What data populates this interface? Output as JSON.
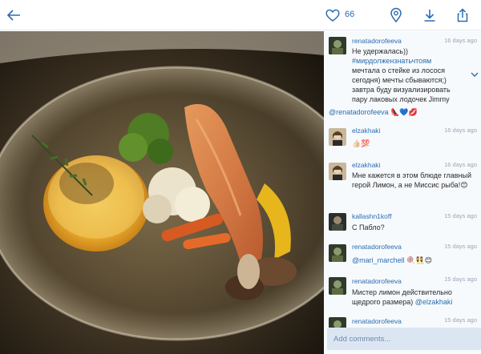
{
  "topbar": {
    "like_count": "66",
    "icons": [
      "back-arrow-icon",
      "heart-icon",
      "location-pin-icon",
      "download-icon",
      "share-icon"
    ]
  },
  "colors": {
    "accent": "#2b6cb0",
    "panel_bg": "#f7fafd",
    "input_bg": "#dce6f2"
  },
  "comments": [
    {
      "user": "renatadorofeeva",
      "time": "16 days ago",
      "lines": [
        "Не удержалась))",
        "#мирдолжензнатьчтоям",
        "мечтала о стейке из лосося",
        "сегодня) мечты сбываются;)",
        "завтра буду визуализировать",
        "пару лаковых лодочек Jimmy"
      ],
      "overflow": "@renatadorofeeva 👠💙💋"
    },
    {
      "user": "elzakhaki",
      "time": "16 days ago",
      "text": "👍🏻💯"
    },
    {
      "user": "elzakhaki",
      "time": "16 days ago",
      "text": "Мне кажется в этом блюде главный герой Лимон, а не Миссис рыба!😊"
    },
    {
      "user": "kallashn1koff",
      "time": "15 days ago",
      "text": "С Пабло?"
    },
    {
      "user": "renatadorofeeva",
      "time": "15 days ago",
      "mention": "@mari_marchell",
      "text": " 🍭👯😊"
    },
    {
      "user": "renatadorofeeva",
      "time": "15 days ago",
      "text": "Мистер лимон действительно щедрого размера) ",
      "mention": "@elzakhaki"
    },
    {
      "user": "renatadorofeeva",
      "time": "15 days ago"
    }
  ],
  "input": {
    "placeholder": "Add comments..."
  }
}
